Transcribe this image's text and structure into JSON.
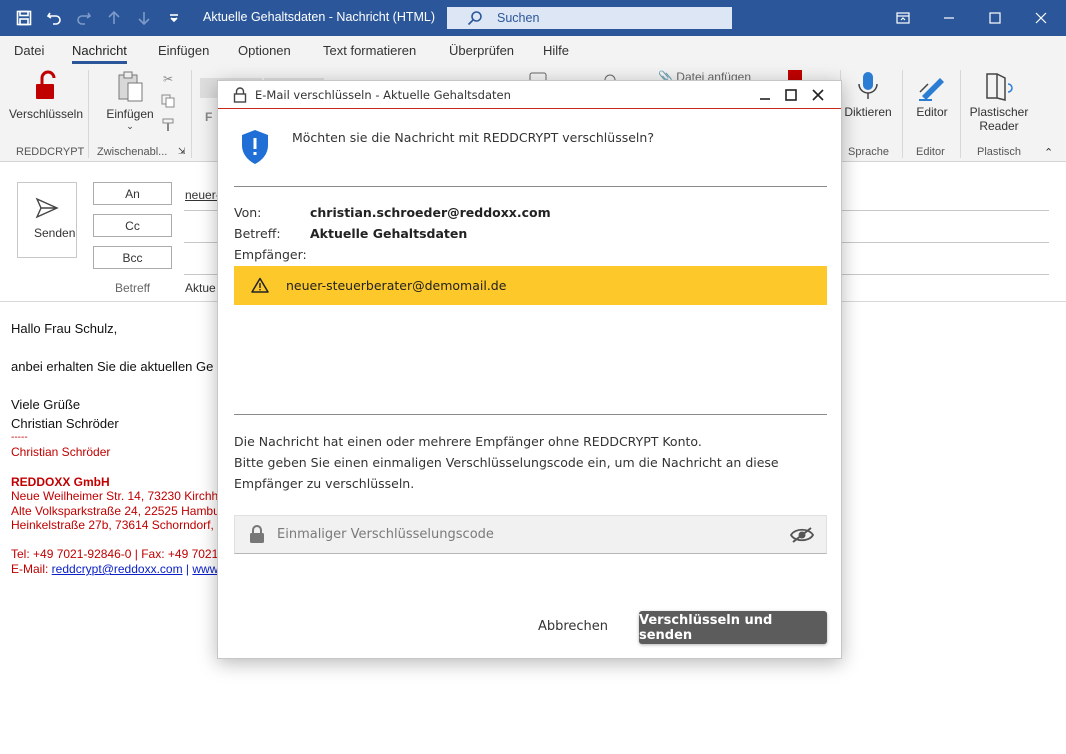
{
  "window": {
    "title": "Aktuelle Gehaltsdaten  -  Nachricht (HTML)",
    "search_label": "Suchen"
  },
  "ribbon": {
    "tabs": [
      "Datei",
      "Nachricht",
      "Einfügen",
      "Optionen",
      "Text formatieren",
      "Überprüfen",
      "Hilfe"
    ],
    "active_tab": "Nachricht",
    "encrypt_label": "Verschlüsseln",
    "group_reddcrypt": "REDDCRYPT",
    "paste_label": "Einfügen",
    "group_clipboard": "Zwischenabl...",
    "attach_partial": "Datei anfügen",
    "dictate_label": "Diktieren",
    "group_speech": "Sprache",
    "editor_label": "Editor",
    "group_editor": "Editor",
    "reader_label_1": "Plastischer",
    "reader_label_2": "Reader",
    "group_immersive": "Plastisch"
  },
  "compose": {
    "send_label": "Senden",
    "to_label": "An",
    "cc_label": "Cc",
    "bcc_label": "Bcc",
    "subject_label": "Betreff",
    "to_value_partial": "neuer-",
    "subject_value_partial": "Aktue"
  },
  "body": {
    "greeting": "Hallo Frau Schulz,",
    "line1": "anbei erhalten Sie die aktuellen Ge",
    "closing": "Viele Grüße",
    "name": "Christian Schröder",
    "sig_dash": "-----",
    "sig_name": "Christian Schröder",
    "sig_company": "REDDOXX GmbH",
    "sig_addr1": "Neue Weilheimer Str. 14, 73230 Kirchh",
    "sig_addr2": "Alte Volksparkstraße 24, 22525 Hambu",
    "sig_addr3": "Heinkelstraße 27b, 73614 Schorndorf,",
    "sig_tel": "Tel: +49 7021-92846-0 | Fax: +49 7021",
    "sig_mail_label": "E-Mail: ",
    "sig_mail": "reddcrypt@reddoxx.com",
    "sig_sep": " | ",
    "sig_www": "www"
  },
  "dialog": {
    "title": "E-Mail verschlüsseln - Aktuelle Gehaltsdaten",
    "question": "Möchten sie die Nachricht mit REDDCRYPT verschlüsseln?",
    "from_label": "Von:",
    "from_value": "christian.schroeder@reddoxx.com",
    "subject_label": "Betreff:",
    "subject_value": "Aktuelle Gehaltsdaten",
    "recipients_label": "Empfänger:",
    "recipient": "neuer-steuerberater@demomail.de",
    "info_line1": "Die Nachricht hat einen oder mehrere Empfänger ohne REDDCRYPT Konto.",
    "info_line2": "Bitte geben Sie einen einmaligen Verschlüsselungscode ein, um die Nachricht an diese Empfänger zu verschlüsseln.",
    "code_placeholder": "Einmaliger Verschlüsselungscode",
    "cancel_label": "Abbrechen",
    "submit_label": "Verschlüsseln und senden",
    "warning_color": "#fcc82a",
    "accent_color": "#2b579a"
  }
}
